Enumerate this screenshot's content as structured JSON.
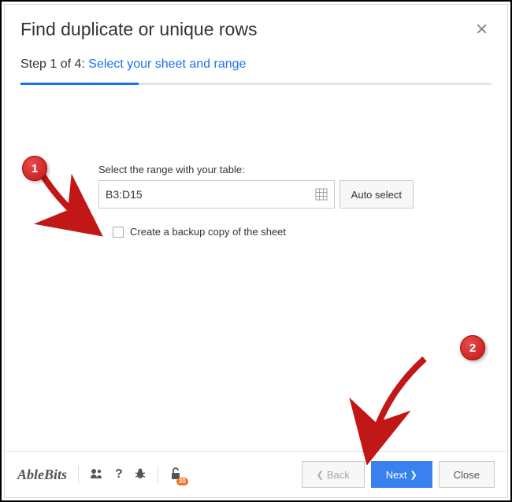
{
  "header": {
    "title": "Find duplicate or unique rows"
  },
  "step": {
    "prefix": "Step 1 of 4: ",
    "link": "Select your sheet and range"
  },
  "form": {
    "rangeLabel": "Select the range with your table:",
    "rangeValue": "B3:D15",
    "autoSelect": "Auto select",
    "backupLabel": "Create a backup copy of the sheet"
  },
  "footer": {
    "brand": "AbleBits",
    "badge": "30",
    "back": "Back",
    "next": "Next",
    "close": "Close"
  },
  "callouts": {
    "one": "1",
    "two": "2"
  }
}
